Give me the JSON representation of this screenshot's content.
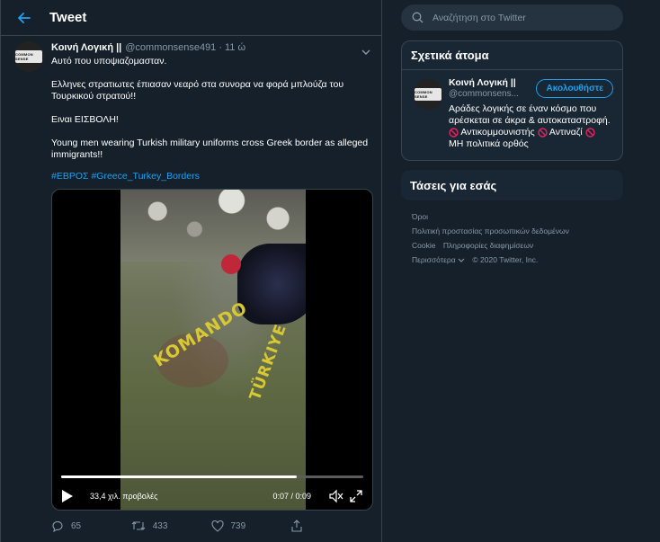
{
  "header": {
    "title": "Tweet"
  },
  "tweet": {
    "display_name": "Κοινή Λογική ||",
    "handle": "@commonsense491",
    "separator": "·",
    "time": "11 ώ",
    "text": [
      "Αυτό που υποψιαζομασταν.",
      "Ελληνες στρατιωτες έπιασαν νεαρό στα συνορα να φορά μπλούζα του Τουρκικού στρατού!!",
      "Ειναι ΕΙΣΒΟΛΗ!",
      "Young men wearing Turkish military uniforms cross Greek border as alleged immigrants!!"
    ],
    "hashtags": [
      "#ΕΒΡΟΣ",
      "#Greece_Turkey_Borders"
    ],
    "video": {
      "views": "33,4 χιλ. προβολές",
      "timecode": "0:07 / 0:09",
      "progress": 0.78,
      "overlay_text_1": "KOMANDO",
      "overlay_text_2": "TÜRKIYE"
    },
    "actions": {
      "replies": "65",
      "retweets": "433",
      "likes": "739"
    },
    "avatar_text": "COMMON SENSE"
  },
  "search": {
    "placeholder": "Αναζήτηση στο Twitter"
  },
  "related": {
    "title": "Σχετικά άτομα",
    "name": "Κοινή Λογική ||",
    "handle": "@commonsens...",
    "follow_label": "Ακολουθήστε",
    "bio_1": "Αράδες λογικής σε έναν κόσμο που αρέσκεται σε άκρα & αυτοκαταστροφή.",
    "bio_2": "Αντικομμουνιστής",
    "bio_3": "Αντιναζί",
    "bio_4": "ΜΗ πολιτικά ορθός"
  },
  "trends": {
    "title": "Τάσεις για εσάς"
  },
  "footer": {
    "terms": "Όροι",
    "privacy": "Πολιτική προστασίας προσωπικών δεδομένων",
    "cookie": "Cookie",
    "ads": "Πληροφορίες διαφημίσεων",
    "more": "Περισσότερα",
    "copyright": "© 2020 Twitter, Inc."
  },
  "colors": {
    "accent": "#1da1f2",
    "background": "#15202b",
    "panel": "#192734",
    "muted": "#8899a6"
  }
}
